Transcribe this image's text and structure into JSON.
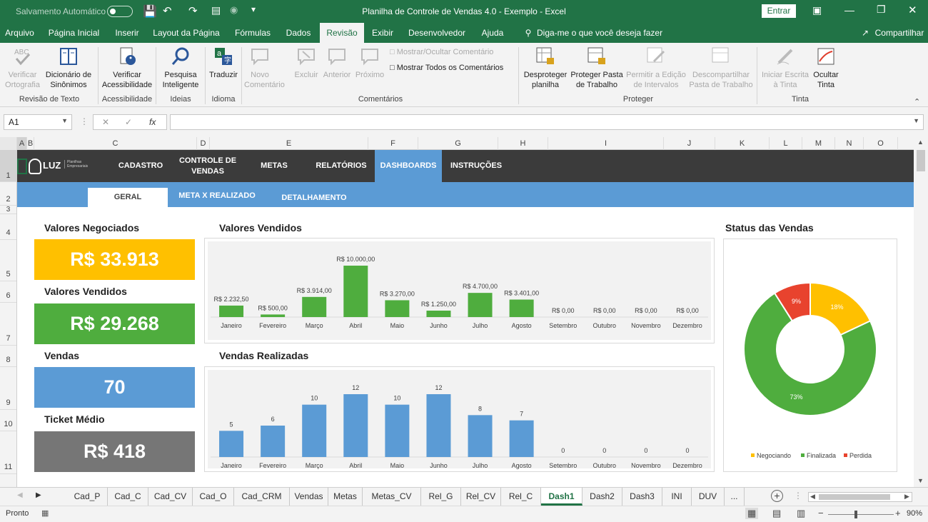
{
  "titlebar": {
    "autosave_label": "Salvamento Automático",
    "title": "Planilha de Controle de Vendas 4.0 - Exemplo  -  Excel",
    "signin": "Entrar"
  },
  "menu": {
    "items": [
      "Arquivo",
      "Página Inicial",
      "Inserir",
      "Layout da Página",
      "Fórmulas",
      "Dados",
      "Revisão",
      "Exibir",
      "Desenvolvedor",
      "Ajuda"
    ],
    "active": "Revisão",
    "tell_me": "Diga-me o que você deseja fazer",
    "share": "Compartilhar"
  },
  "ribbon": {
    "buttons": {
      "spelling": "Verificar Ortografia",
      "thesaurus": "Dicionário de Sinônimos",
      "accessibility": "Verificar Acessibilidade",
      "smart_lookup": "Pesquisa Inteligente",
      "translate": "Traduzir",
      "new_comment": "Novo Comentário",
      "delete": "Excluir",
      "previous": "Anterior",
      "next": "Próximo",
      "show_hide_comment": "Mostrar/Ocultar Comentário",
      "show_all_comments": "Mostrar Todos os Comentários",
      "unprotect_sheet": "Desproteger planilha",
      "protect_workbook": "Proteger Pasta de Trabalho",
      "allow_edit_ranges": "Permitir a Edição de Intervalos",
      "unshare_workbook": "Descompartilhar Pasta de Trabalho",
      "start_inking": "Iniciar Escrita à Tinta",
      "hide_ink": "Ocultar Tinta"
    },
    "groups": {
      "proofing": "Revisão de Texto",
      "accessibility": "Acessibilidade",
      "insights": "Ideias",
      "language": "Idioma",
      "comments": "Comentários",
      "protect": "Proteger",
      "ink": "Tinta"
    }
  },
  "formula_bar": {
    "name_box": "A1",
    "fx": "fx",
    "value": ""
  },
  "columns": [
    "A",
    "B",
    "C",
    "D",
    "E",
    "F",
    "G",
    "H",
    "I",
    "J",
    "K",
    "L",
    "M",
    "N",
    "O"
  ],
  "rows": [
    "1",
    "2",
    "3",
    "4",
    "5",
    "6",
    "7",
    "8",
    "9",
    "10",
    "11"
  ],
  "dashboard": {
    "logo": "LUZ",
    "logo_sub": "Planilhas Empresariais",
    "nav": [
      "CADASTRO",
      "CONTROLE DE VENDAS",
      "METAS",
      "RELATÓRIOS",
      "DASHBOARDS",
      "INSTRUÇÕES"
    ],
    "nav_active": "DASHBOARDS",
    "subnav": [
      "GERAL",
      "META X REALIZADO",
      "DETALHAMENTO"
    ],
    "subnav_active": "GERAL",
    "kpis": [
      {
        "label": "Valores Negociados",
        "value": "R$ 33.913",
        "color": "#ffc000"
      },
      {
        "label": "Valores Vendidos",
        "value": "R$ 29.268",
        "color": "#4fad3e"
      },
      {
        "label": "Vendas",
        "value": "70",
        "color": "#5b9bd5"
      },
      {
        "label": "Ticket Médio",
        "value": "R$ 418",
        "color": "#767676"
      }
    ]
  },
  "chart_data": [
    {
      "type": "bar",
      "title": "Valores Vendidos",
      "categories": [
        "Janeiro",
        "Fevereiro",
        "Março",
        "Abril",
        "Maio",
        "Junho",
        "Julho",
        "Agosto",
        "Setembro",
        "Outubro",
        "Novembro",
        "Dezembro"
      ],
      "values": [
        2232.5,
        500,
        3914,
        10000,
        3270,
        1250,
        4700,
        3401,
        0,
        0,
        0,
        0
      ],
      "data_labels": [
        "R$ 2.232,50",
        "R$ 500,00",
        "R$ 3.914,00",
        "R$ 10.000,00",
        "R$ 3.270,00",
        "R$ 1.250,00",
        "R$ 4.700,00",
        "R$ 3.401,00",
        "R$ 0,00",
        "R$ 0,00",
        "R$ 0,00",
        "R$ 0,00"
      ],
      "color": "#4fad3e",
      "ylim": [
        0,
        10000
      ]
    },
    {
      "type": "bar",
      "title": "Vendas Realizadas",
      "categories": [
        "Janeiro",
        "Fevereiro",
        "Março",
        "Abril",
        "Maio",
        "Junho",
        "Julho",
        "Agosto",
        "Setembro",
        "Outubro",
        "Novembro",
        "Dezembro"
      ],
      "values": [
        5,
        6,
        10,
        12,
        10,
        12,
        8,
        7,
        0,
        0,
        0,
        0
      ],
      "data_labels": [
        "5",
        "6",
        "10",
        "12",
        "10",
        "12",
        "8",
        "7",
        "0",
        "0",
        "0",
        "0"
      ],
      "color": "#5b9bd5",
      "ylim": [
        0,
        12
      ]
    },
    {
      "type": "pie",
      "title": "Status das Vendas",
      "series": [
        {
          "name": "Negociando",
          "value": 18,
          "label": "18%",
          "color": "#ffc000"
        },
        {
          "name": "Finalizada",
          "value": 73,
          "label": "73%",
          "color": "#4fad3e"
        },
        {
          "name": "Perdida",
          "value": 9,
          "label": "9%",
          "color": "#e8432e"
        }
      ],
      "legend": "bottom"
    }
  ],
  "sheet_tabs": [
    "Cad_P",
    "Cad_C",
    "Cad_CV",
    "Cad_O",
    "Cad_CRM",
    "Vendas",
    "Metas",
    "Metas_CV",
    "Rel_G",
    "Rel_CV",
    "Rel_C",
    "Dash1",
    "Dash2",
    "Dash3",
    "INI",
    "DUV",
    "..."
  ],
  "active_tab": "Dash1",
  "status": {
    "ready": "Pronto",
    "zoom": "90%"
  }
}
